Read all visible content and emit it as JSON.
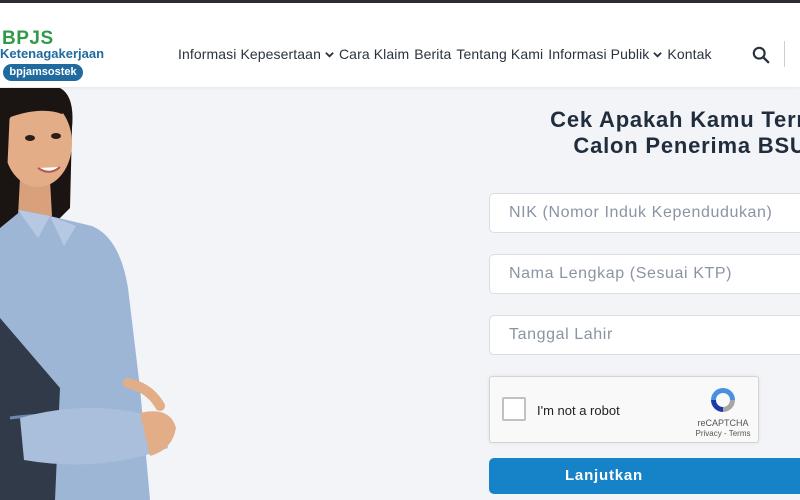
{
  "header": {
    "logo": {
      "brand": "BPJS",
      "subtitle": "Ketenagakerjaan",
      "pill": "bpjamsostek"
    },
    "nav": [
      {
        "label": "Informasi Kepesertaan",
        "has_dropdown": true
      },
      {
        "label": "Cara Klaim",
        "has_dropdown": false
      },
      {
        "label": "Berita",
        "has_dropdown": false
      },
      {
        "label": "Tentang Kami",
        "has_dropdown": false
      },
      {
        "label": "Informasi Publik",
        "has_dropdown": true
      },
      {
        "label": "Kontak",
        "has_dropdown": false
      }
    ],
    "search_icon": "search-icon"
  },
  "form": {
    "title_line1": "Cek Apakah Kamu Terma",
    "title_line2": "Calon Penerima BSU",
    "nik_placeholder": "NIK (Nomor Induk Kependudukan)",
    "name_placeholder": "Nama Lengkap (Sesuai KTP)",
    "dob_placeholder": "Tanggal Lahir",
    "captcha": {
      "label": "I'm not a robot",
      "brand": "reCAPTCHA",
      "links": "Privacy - Terms"
    },
    "submit_label": "Lanjutkan"
  },
  "colors": {
    "brand_green": "#2f9b48",
    "brand_blue": "#1f6a9e",
    "button_blue": "#1683c9"
  }
}
